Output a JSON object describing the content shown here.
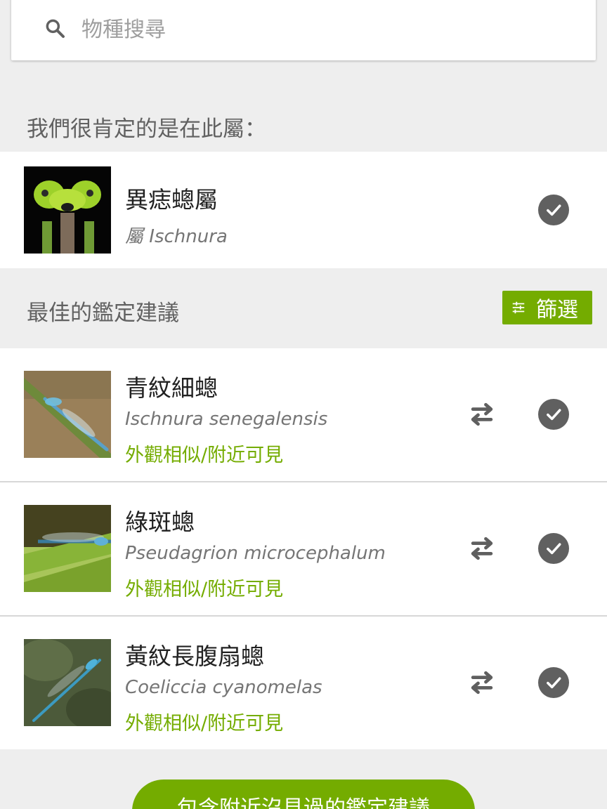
{
  "search": {
    "placeholder": "物種搜尋",
    "icon": "search-icon"
  },
  "genus_section": {
    "heading": "我們很肯定的是在此屬：",
    "item": {
      "name": "異痣蟌屬",
      "rank": "屬",
      "scientific": "Ischnura",
      "icon": "check-circle-icon"
    }
  },
  "suggestions_section": {
    "heading": "最佳的鑑定建議",
    "filter_label": "篩選",
    "items": [
      {
        "name": "青紋細蟌",
        "scientific": "Ischnura senegalensis",
        "tag": "外觀相似/附近可見"
      },
      {
        "name": "綠斑蟌",
        "scientific": "Pseudagrion microcephalum",
        "tag": "外觀相似/附近可見"
      },
      {
        "name": "黃紋長腹扇蟌",
        "scientific": "Coeliccia cyanomelas",
        "tag": "外觀相似/附近可見"
      }
    ]
  },
  "bottom_button": {
    "label": "包含附近沒見過的鑑定建議"
  },
  "colors": {
    "accent": "#74ac00",
    "icon_gray": "#606060",
    "background": "#eeeeee"
  }
}
